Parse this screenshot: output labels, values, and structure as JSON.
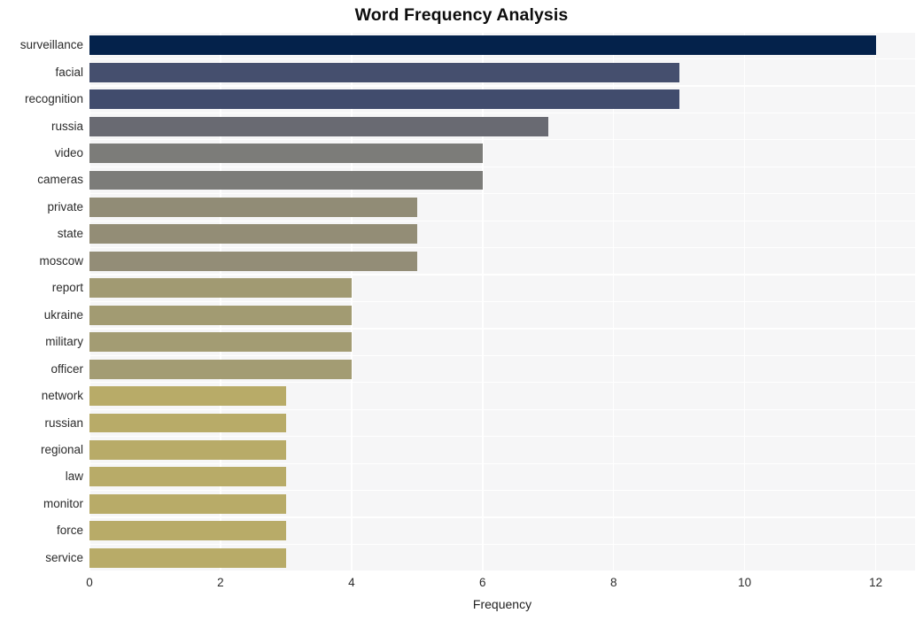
{
  "chart_data": {
    "type": "bar",
    "orientation": "horizontal",
    "title": "Word Frequency Analysis",
    "xlabel": "Frequency",
    "ylabel": "",
    "xlim": [
      0,
      12.6
    ],
    "xticks": [
      0,
      2,
      4,
      6,
      8,
      10,
      12
    ],
    "xtick_labels": [
      "0",
      "2",
      "4",
      "6",
      "8",
      "10",
      "12"
    ],
    "grid": true,
    "grid_color": "#ffffff",
    "legend": "none",
    "plot_background": "#f6f6f7",
    "figure_background": "#ffffff",
    "categories": [
      "surveillance",
      "facial",
      "recognition",
      "russia",
      "video",
      "cameras",
      "private",
      "state",
      "moscow",
      "report",
      "ukraine",
      "military",
      "officer",
      "network",
      "russian",
      "regional",
      "law",
      "monitor",
      "force",
      "service"
    ],
    "values": [
      12,
      9,
      9,
      7,
      6,
      6,
      5,
      5,
      5,
      4,
      4,
      4,
      4,
      3,
      3,
      3,
      3,
      3,
      3,
      3
    ],
    "bar_colors": [
      "#04224b",
      "#454f6e",
      "#414c6d",
      "#696a72",
      "#7c7c79",
      "#7c7c79",
      "#918c76",
      "#938d76",
      "#938d77",
      "#a19a72",
      "#a29b72",
      "#a39c73",
      "#a39c73",
      "#b8ab68",
      "#b8ab68",
      "#b8ab68",
      "#b8ab68",
      "#b8ab68",
      "#b8ab68",
      "#b8ab68"
    ]
  },
  "colors": {
    "title_text": "#0d0d0d",
    "tick_text": "#2b2b2b",
    "axis_label_text": "#1f1f1f",
    "accent_high": "#04224b",
    "accent_low": "#b8ab68"
  }
}
